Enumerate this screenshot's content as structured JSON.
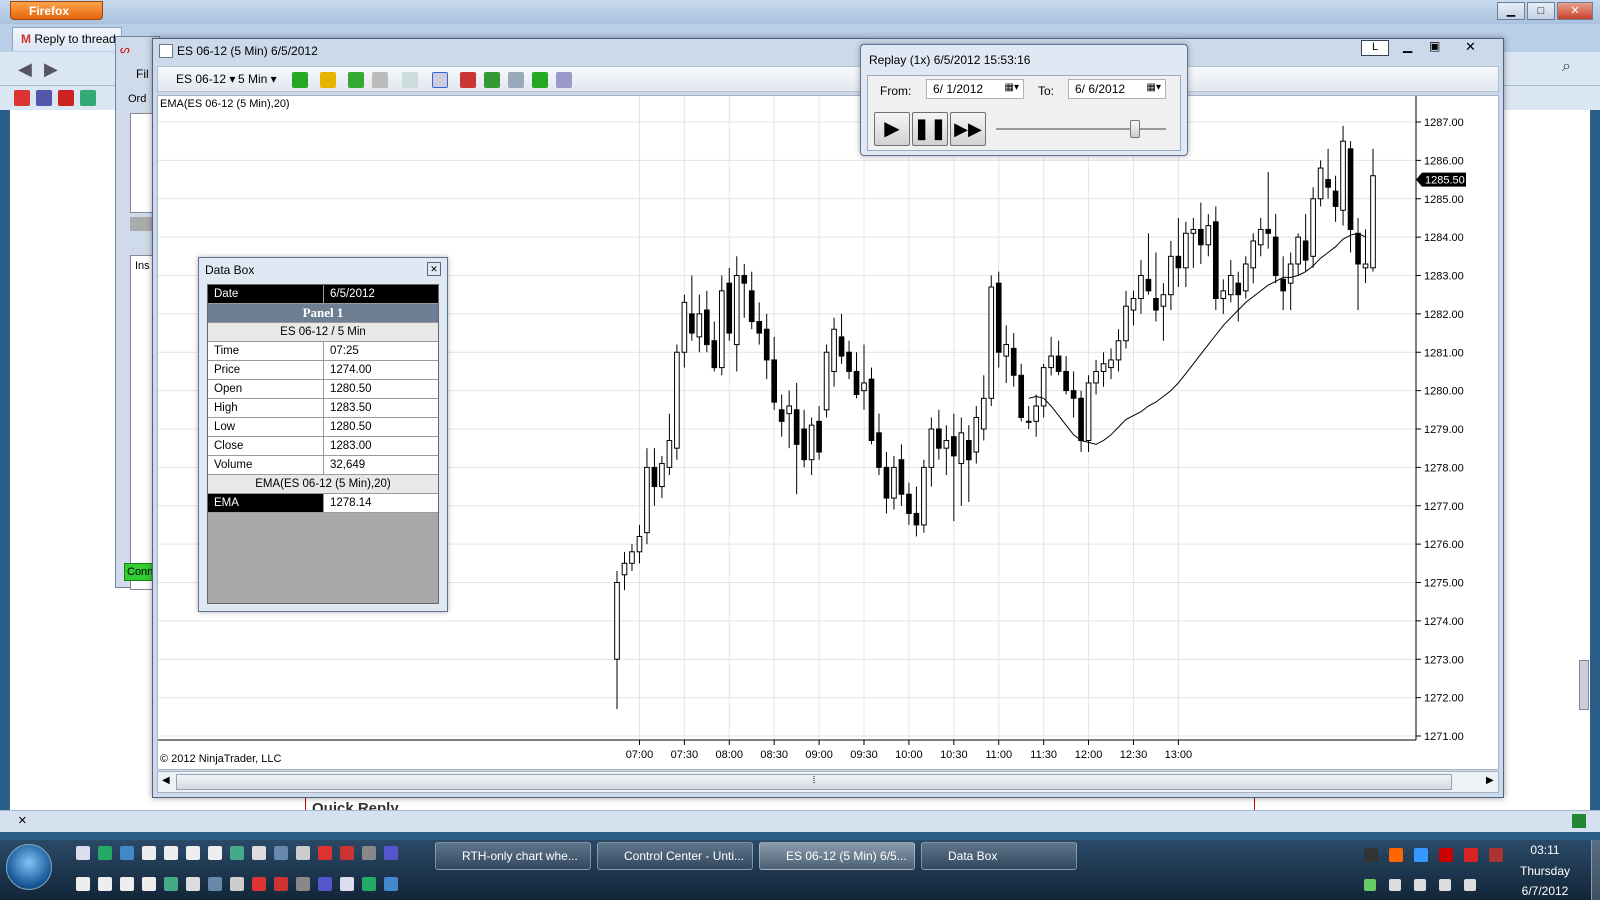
{
  "browser": {
    "button_label": "Firefox",
    "tabs": [
      "Reply to thread"
    ],
    "menu_file": "Fil",
    "quick_reply": "Quick Reply",
    "status_close": "×"
  },
  "control_center": {
    "orders_label": "Ord",
    "ins_label": "Ins",
    "conn_label": "Conn"
  },
  "chart_window": {
    "title": "ES 06-12 (5 Min)  6/5/2012",
    "instrument": "ES 06-12",
    "interval": "5 Min",
    "indicator_label": "EMA(ES 06-12 (5 Min),20)",
    "copyright": "© 2012 NinjaTrader, LLC",
    "current_price": "1285.50",
    "btn_l": "L"
  },
  "replay": {
    "title": "Replay (1x) 6/5/2012 15:53:16",
    "from_label": "From:",
    "from_value": "6/ 1/2012",
    "to_label": "To:",
    "to_value": "6/ 6/2012",
    "slider_position": 0.82
  },
  "data_box": {
    "title": "Data Box",
    "date_label": "Date",
    "date_value": "6/5/2012",
    "panel_label": "Panel 1",
    "series_label": "ES 06-12 / 5 Min",
    "rows": [
      {
        "label": "Time",
        "value": "07:25"
      },
      {
        "label": "Price",
        "value": "1274.00"
      },
      {
        "label": "Open",
        "value": "1280.50"
      },
      {
        "label": "High",
        "value": "1283.50"
      },
      {
        "label": "Low",
        "value": "1280.50"
      },
      {
        "label": "Close",
        "value": "1283.00"
      },
      {
        "label": "Volume",
        "value": "32,649"
      }
    ],
    "indicator_label": "EMA(ES 06-12 (5 Min),20)",
    "ema_label": "EMA",
    "ema_value": "1278.14"
  },
  "taskbar": {
    "buttons": [
      "RTH-only chart whe...",
      "Control Center - Unti...",
      "ES 06-12 (5 Min)  6/5...",
      "Data Box"
    ],
    "time": "03:11",
    "day": "Thursday",
    "date": "6/7/2012"
  },
  "colors": {
    "up": "#ffffff",
    "down": "#000000",
    "ema": "#000000",
    "grid": "#e4e4e4"
  },
  "chart_data": {
    "type": "candlestick",
    "ylim": [
      1271,
      1287.5
    ],
    "yticks": [
      "1271.00",
      "1272.00",
      "1273.00",
      "1274.00",
      "1275.00",
      "1276.00",
      "1277.00",
      "1278.00",
      "1279.00",
      "1280.00",
      "1281.00",
      "1282.00",
      "1283.00",
      "1284.00",
      "1285.00",
      "1286.00",
      "1287.00"
    ],
    "xticks": [
      "07:00",
      "07:30",
      "08:00",
      "08:30",
      "09:00",
      "09:30",
      "10:00",
      "10:30",
      "11:00",
      "11:30",
      "12:00",
      "12:30",
      "13:00"
    ],
    "first_bar_minutes": 405,
    "bar_minutes": 5,
    "ohlc": [
      [
        1273,
        1275.3,
        1271.7,
        1275
      ],
      [
        1275.2,
        1275.8,
        1274.8,
        1275.5
      ],
      [
        1275.5,
        1276,
        1275.3,
        1275.8
      ],
      [
        1275.8,
        1276.5,
        1275.5,
        1276.2
      ],
      [
        1276.3,
        1278.5,
        1276,
        1278
      ],
      [
        1278,
        1278.5,
        1277,
        1277.5
      ],
      [
        1277.5,
        1278.3,
        1277.2,
        1278.1
      ],
      [
        1278,
        1279.4,
        1277.8,
        1278.7
      ],
      [
        1278.5,
        1281.2,
        1278.2,
        1281
      ],
      [
        1281,
        1282.5,
        1280.6,
        1282.3
      ],
      [
        1282,
        1283,
        1281.3,
        1281.5
      ],
      [
        1281.4,
        1282.5,
        1281,
        1282
      ],
      [
        1282.1,
        1282.6,
        1281,
        1281.2
      ],
      [
        1281.3,
        1281.8,
        1280.5,
        1280.6
      ],
      [
        1280.6,
        1283,
        1280.4,
        1282.6
      ],
      [
        1282.8,
        1283.2,
        1281.3,
        1281.5
      ],
      [
        1281.2,
        1283.5,
        1280.5,
        1283
      ],
      [
        1283,
        1283.3,
        1281.9,
        1282.8
      ],
      [
        1282.6,
        1283.1,
        1281.6,
        1281.8
      ],
      [
        1281.8,
        1282.3,
        1281.2,
        1281.5
      ],
      [
        1281.6,
        1282,
        1280.3,
        1280.8
      ],
      [
        1280.8,
        1281.4,
        1279.5,
        1279.7
      ],
      [
        1279.5,
        1279.9,
        1278.8,
        1279.2
      ],
      [
        1279.4,
        1280,
        1278.5,
        1279.6
      ],
      [
        1279.5,
        1280.2,
        1277.3,
        1278.6
      ],
      [
        1279,
        1279.5,
        1278,
        1278.2
      ],
      [
        1278.2,
        1279.3,
        1277.8,
        1279.1
      ],
      [
        1279.2,
        1279.6,
        1278.2,
        1278.4
      ],
      [
        1279.5,
        1281.2,
        1279.3,
        1281
      ],
      [
        1280.5,
        1281.9,
        1280.1,
        1281.6
      ],
      [
        1281.4,
        1282,
        1280.7,
        1280.9
      ],
      [
        1281,
        1281.3,
        1280.3,
        1280.5
      ],
      [
        1280.5,
        1281,
        1279.8,
        1279.9
      ],
      [
        1280,
        1281.2,
        1279.5,
        1280.2
      ],
      [
        1280.3,
        1280.6,
        1278.6,
        1278.7
      ],
      [
        1278.9,
        1279.4,
        1277.8,
        1278
      ],
      [
        1278,
        1278.4,
        1276.8,
        1277.2
      ],
      [
        1277.2,
        1278.3,
        1276.9,
        1278
      ],
      [
        1278.2,
        1278.6,
        1277,
        1277.3
      ],
      [
        1277.3,
        1277.6,
        1276.5,
        1276.8
      ],
      [
        1276.8,
        1277.5,
        1276.2,
        1276.5
      ],
      [
        1276.5,
        1278.2,
        1276.3,
        1278
      ],
      [
        1278,
        1279.3,
        1277.5,
        1279
      ],
      [
        1279,
        1279.5,
        1278.2,
        1278.5
      ],
      [
        1278.5,
        1279.1,
        1277.8,
        1278.7
      ],
      [
        1278.8,
        1279.4,
        1276.6,
        1278.3
      ],
      [
        1278.1,
        1279.3,
        1277,
        1278.9
      ],
      [
        1278.7,
        1279.1,
        1277.1,
        1278.2
      ],
      [
        1278.4,
        1279.6,
        1278.1,
        1279.3
      ],
      [
        1279,
        1280.4,
        1278.7,
        1279.8
      ],
      [
        1279.8,
        1283,
        1279.6,
        1282.7
      ],
      [
        1282.8,
        1283.1,
        1280.6,
        1281
      ],
      [
        1280.9,
        1281.7,
        1280.2,
        1281.2
      ],
      [
        1281.1,
        1281.5,
        1280.1,
        1280.4
      ],
      [
        1280.4,
        1280.7,
        1279.2,
        1279.3
      ],
      [
        1279.2,
        1279.6,
        1279
      ],
      [
        1279.2,
        1279.9,
        1278.8,
        1279.6
      ],
      [
        1279.6,
        1280.7,
        1279.3,
        1280.6
      ],
      [
        1280.6,
        1281.4,
        1280.4,
        1280.9
      ],
      [
        1280.9,
        1281.3,
        1280.4,
        1280.5
      ],
      [
        1280.5,
        1280.9,
        1279.9,
        1280
      ],
      [
        1280,
        1280.5,
        1279.3,
        1279.8
      ],
      [
        1279.8,
        1280,
        1278.4,
        1278.7
      ],
      [
        1278.7,
        1280.4,
        1278.4,
        1280.2
      ],
      [
        1280.2,
        1280.8,
        1279.9,
        1280.5
      ],
      [
        1280.5,
        1281,
        1280.1,
        1280.7
      ],
      [
        1280.6,
        1281.1,
        1280.3,
        1280.8
      ],
      [
        1280.8,
        1281.6,
        1280.5,
        1281.3
      ],
      [
        1281.3,
        1282.6,
        1281.1,
        1282.2
      ],
      [
        1282.1,
        1282.6,
        1281.7,
        1282.4
      ],
      [
        1282.4,
        1283.4,
        1282,
        1283
      ],
      [
        1282.9,
        1284.1,
        1282.5,
        1282.6
      ],
      [
        1282.4,
        1283.6,
        1281.8,
        1282.1
      ],
      [
        1282.2,
        1282.8,
        1281.3,
        1282.5
      ],
      [
        1282.5,
        1283.9,
        1282.1,
        1283.5
      ],
      [
        1283.5,
        1284.5,
        1282.7,
        1283.2
      ],
      [
        1283.2,
        1284.4,
        1282.7,
        1284.1
      ],
      [
        1284.1,
        1284.5,
        1283.2,
        1284.2
      ],
      [
        1284.2,
        1284.9,
        1283.3,
        1283.8
      ],
      [
        1283.8,
        1284.6,
        1283.5,
        1284.3
      ],
      [
        1284.4,
        1284.8,
        1282.1,
        1282.4
      ],
      [
        1282.4,
        1282.9,
        1282,
        1282.6
      ],
      [
        1282.5,
        1283.4,
        1282.3,
        1283
      ],
      [
        1282.8,
        1283.1,
        1281.8,
        1282.5
      ],
      [
        1282.6,
        1283.5,
        1282.4,
        1283.3
      ],
      [
        1283.2,
        1284.1,
        1282.8,
        1283.9
      ],
      [
        1283.8,
        1284.5,
        1283.5,
        1284.2
      ],
      [
        1284.2,
        1285.7,
        1283.7,
        1284.1
      ],
      [
        1284,
        1284.6,
        1282.8,
        1283
      ],
      [
        1282.9,
        1283.5,
        1282.1,
        1282.6
      ],
      [
        1282.8,
        1283.6,
        1282.1,
        1283.3
      ],
      [
        1283.3,
        1284.1,
        1283,
        1284
      ],
      [
        1283.9,
        1284.6,
        1283.1,
        1283.4
      ],
      [
        1283.5,
        1285.3,
        1283.2,
        1285
      ],
      [
        1285,
        1286,
        1284.8,
        1285.8
      ],
      [
        1285.5,
        1286.3,
        1285,
        1285.3
      ],
      [
        1285.2,
        1285.6,
        1284.4,
        1284.8
      ],
      [
        1284.7,
        1286.9,
        1284.3,
        1286.5
      ],
      [
        1286.3,
        1286.5,
        1283.6,
        1284.2
      ],
      [
        1284.1,
        1284.5,
        1282.1,
        1283.3
      ],
      [
        1283.2,
        1284.2,
        1282.8,
        1283.3
      ],
      [
        1283.2,
        1286.3,
        1283.1,
        1285.6
      ]
    ],
    "ema": [
      1279.8,
      1279.85,
      1279.8,
      1279.6,
      1279.35,
      1279.1,
      1278.85,
      1278.7,
      1278.65,
      1278.6,
      1278.7,
      1278.85,
      1279.05,
      1279.25,
      1279.35,
      1279.45,
      1279.6,
      1279.7,
      1279.85,
      1280,
      1280.2,
      1280.45,
      1280.7,
      1280.95,
      1281.2,
      1281.45,
      1281.7,
      1281.9,
      1282.1,
      1282.3,
      1282.45,
      1282.6,
      1282.75,
      1282.85,
      1282.95,
      1282.95,
      1283,
      1283.1,
      1283.25,
      1283.45,
      1283.6,
      1283.75,
      1283.95,
      1284.05,
      1284.1,
      1284
    ],
    "ema_start_index": 55
  }
}
